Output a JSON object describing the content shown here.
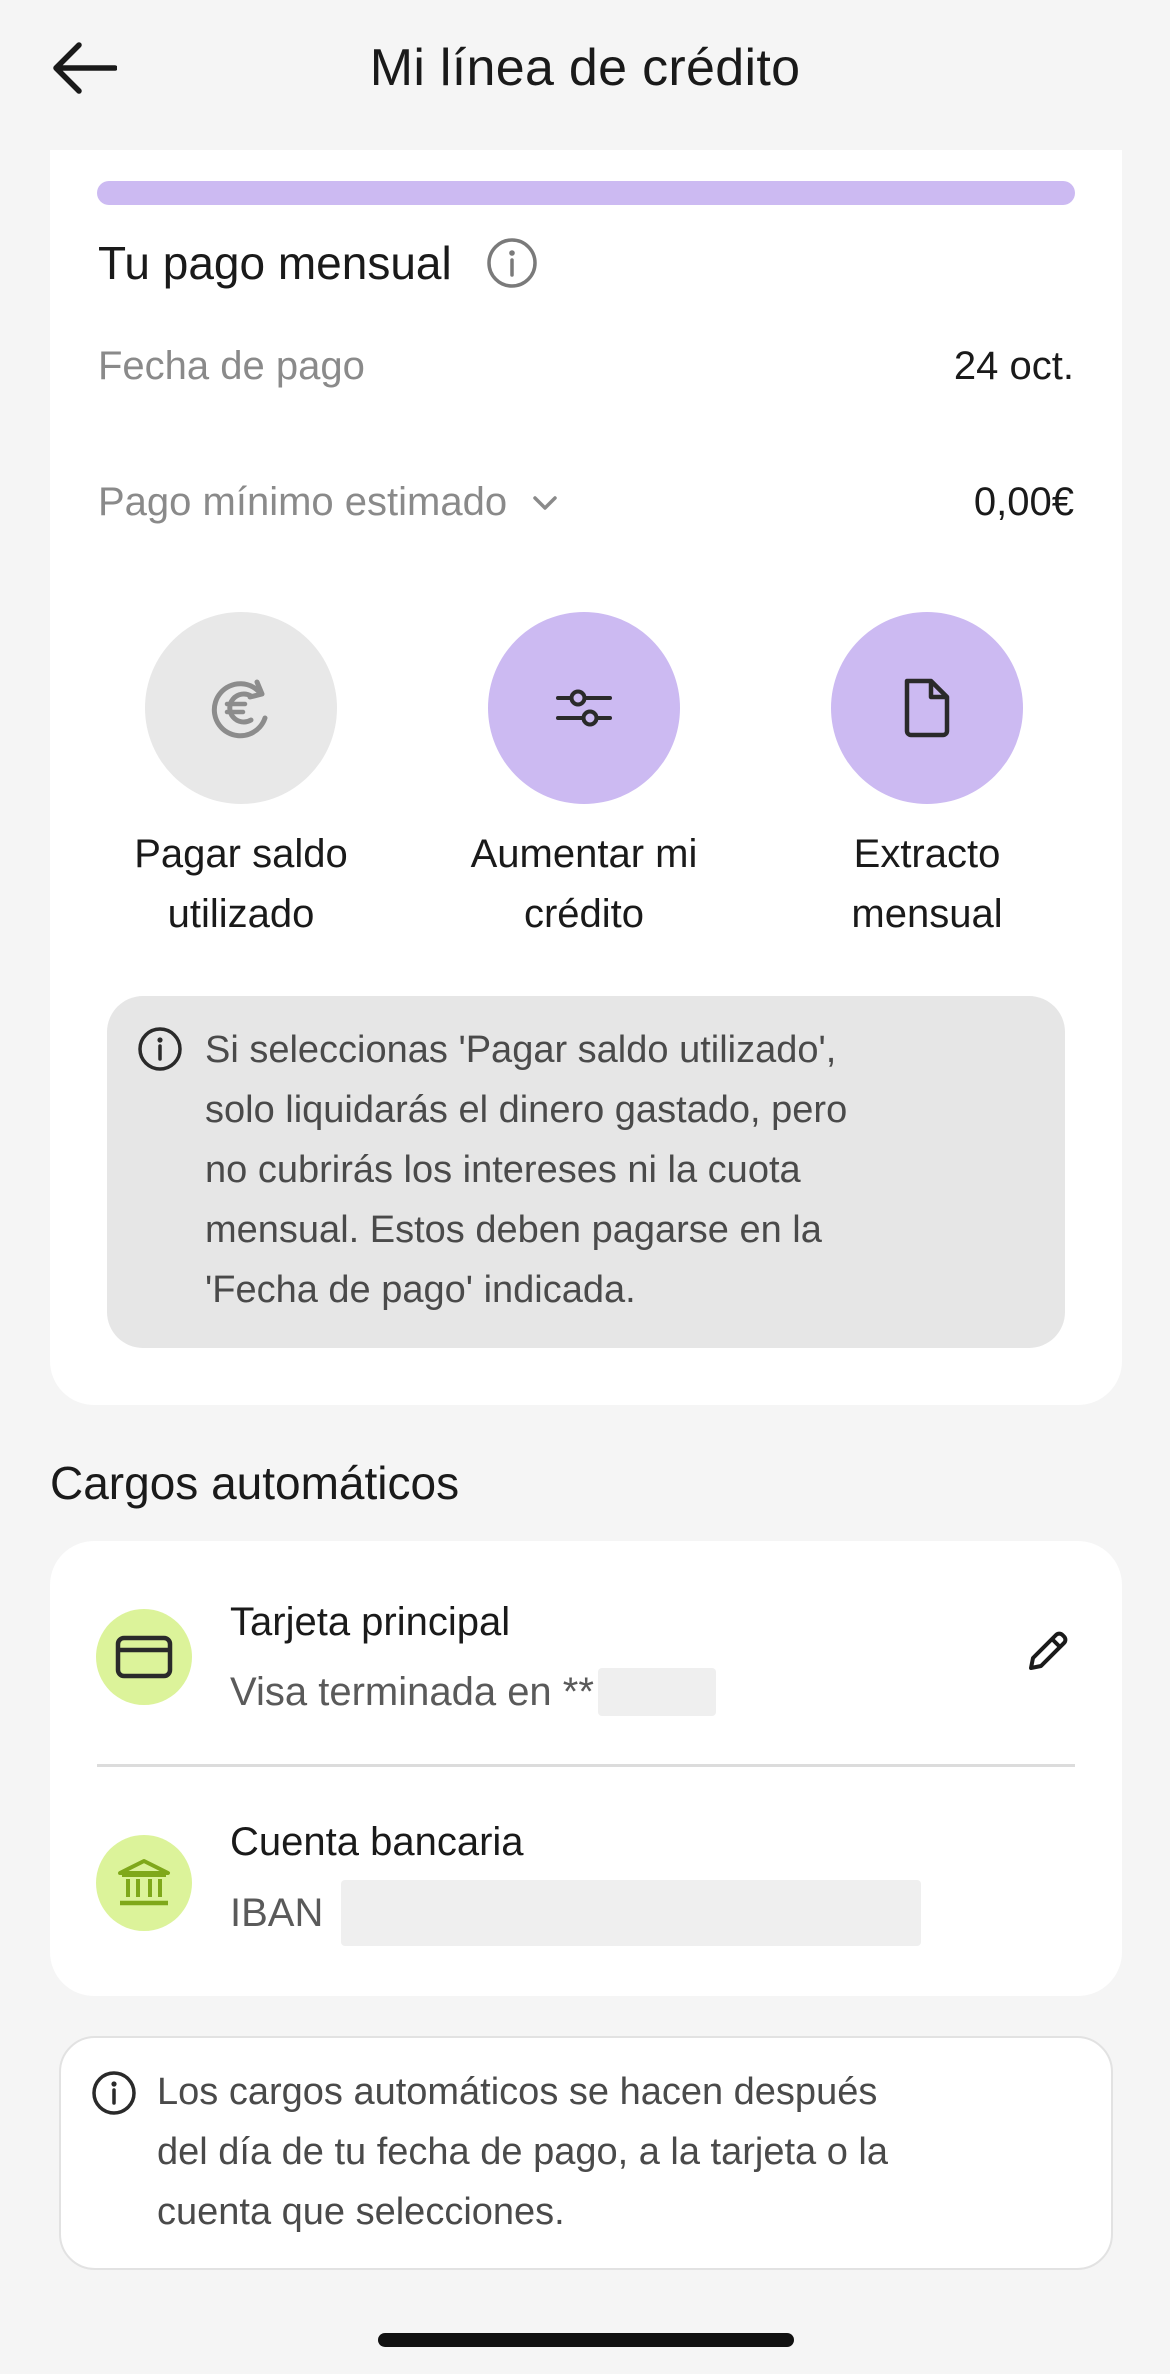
{
  "header": {
    "title": "Mi línea de crédito",
    "back_icon": "arrow-left-icon"
  },
  "credit_line": {
    "bar_color": "#ccbaf2"
  },
  "monthly_payment": {
    "title": "Tu pago mensual",
    "payment_date_label": "Fecha de pago",
    "payment_date_value": "24 oct.",
    "min_payment_label": "Pago mínimo estimado",
    "min_payment_value": "0,00€"
  },
  "actions": [
    {
      "label_line1": "Pagar saldo",
      "label_line2": "utilizado",
      "icon": "euro-refresh-icon",
      "enabled": false
    },
    {
      "label_line1": "Aumentar mi",
      "label_line2": "crédito",
      "icon": "sliders-icon",
      "enabled": true
    },
    {
      "label_line1": "Extracto",
      "label_line2": "mensual",
      "icon": "document-icon",
      "enabled": true
    }
  ],
  "notice": {
    "lines": [
      "Si seleccionas 'Pagar saldo utilizado',",
      "solo liquidarás el dinero gastado, pero",
      "no cubrirás los intereses ni la cuota",
      "mensual. Estos deben pagarse en la",
      "'Fecha de pago' indicada."
    ]
  },
  "automatic_charges": {
    "title": "Cargos automáticos",
    "card": {
      "name": "Tarjeta principal",
      "sub": "Visa terminada en **"
    },
    "bank": {
      "name": "Cuenta bancaria",
      "sub": "IBAN"
    }
  },
  "footer_note": {
    "lines": [
      "Los cargos automáticos se hacen después",
      "del día de tu fecha de pago, a la tarjeta o la",
      "cuenta que selecciones."
    ]
  },
  "colors": {
    "accent_purple": "#ccbaf2",
    "accent_green": "#dcf39a",
    "disabled_gray": "#e8e8e8"
  }
}
